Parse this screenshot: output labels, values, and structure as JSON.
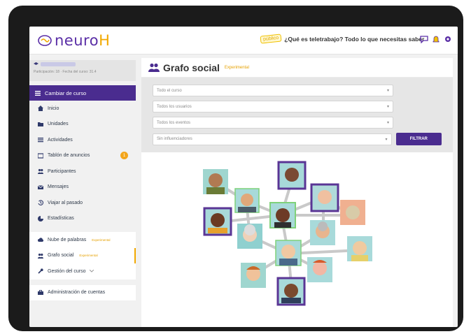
{
  "app": {
    "logo_text_1": "neuro",
    "logo_text_2": "H"
  },
  "topbar": {
    "badge": "público",
    "promo": "¿Qué es teletrabajo? Todo lo que necesitas saber",
    "accent": "#4a2c8f",
    "highlight": "#f2a900"
  },
  "sidebar": {
    "change_course": "Cambiar de curso",
    "user_sub": "Participación: 18 · Fecha del curso: 31.4",
    "items": [
      {
        "label": "Inicio",
        "icon": "home-icon"
      },
      {
        "label": "Unidades",
        "icon": "folder-icon"
      },
      {
        "label": "Actividades",
        "icon": "list-icon"
      },
      {
        "label": "Tablón de anuncios",
        "icon": "board-icon",
        "count": "1"
      },
      {
        "label": "Participantes",
        "icon": "users-icon"
      },
      {
        "label": "Mensajes",
        "icon": "mail-icon"
      },
      {
        "label": "Viajar al pasado",
        "icon": "history-icon"
      },
      {
        "label": "Estadísticas",
        "icon": "stats-icon"
      }
    ],
    "extras": [
      {
        "label": "Nube de palabras",
        "tag": "Experimental",
        "icon": "cloud-icon"
      },
      {
        "label": "Grafo social",
        "tag": "Experimental",
        "icon": "users-icon"
      },
      {
        "label": "Gestión del curso",
        "icon": "wrench-icon"
      }
    ],
    "admin": "Administración de cuentas"
  },
  "main": {
    "title": "Grafo social",
    "title_tag": "Experimental",
    "filters": [
      "Todo el curso",
      "Todos los usuarios",
      "Todos los eventos",
      "Sin influenciadores"
    ],
    "filter_button": "FILTRAR"
  }
}
